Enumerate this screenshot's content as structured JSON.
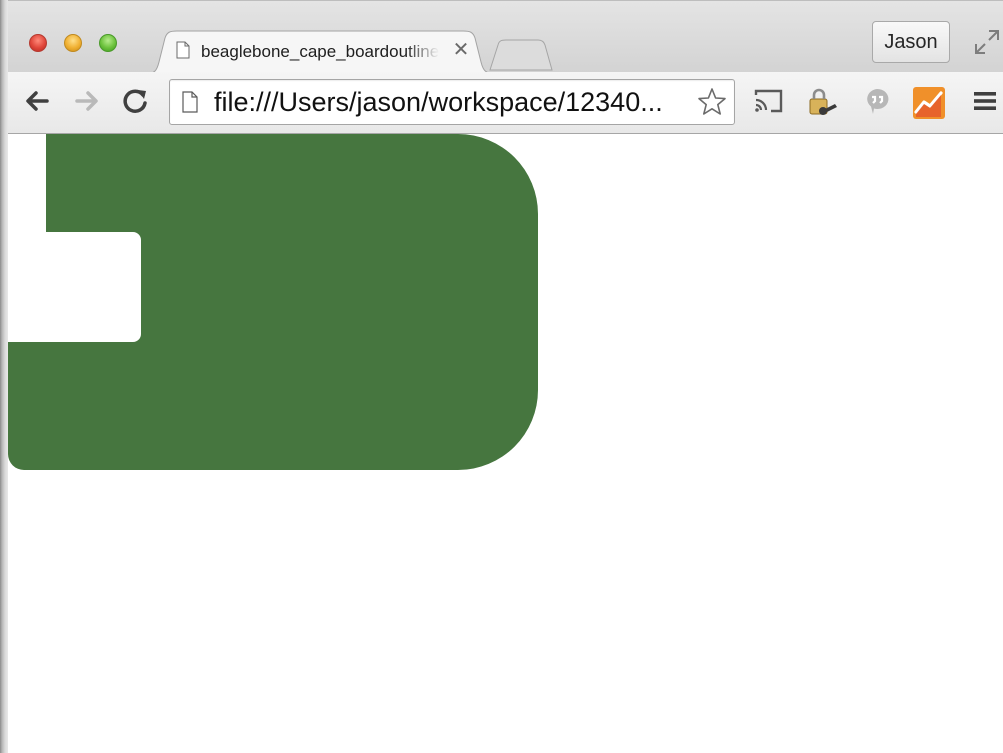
{
  "window": {
    "controls": [
      "close-icon",
      "minimize-icon",
      "maximize-icon"
    ],
    "colors": {
      "close": "#e0463a",
      "minimize": "#f0b032",
      "maximize": "#6cc23c"
    }
  },
  "tabs": [
    {
      "title": "beaglebone_cape_boardoutline",
      "icon": "document-icon",
      "close_glyph": "✕",
      "active": true
    }
  ],
  "new_tab": {
    "icon": "new-tab-icon"
  },
  "profile": {
    "label": "Jason"
  },
  "toolbar": {
    "back_icon": "back-arrow-icon",
    "forward_icon": "forward-arrow-icon",
    "reload_icon": "reload-icon",
    "address": "file:///Users/jason/workspace/12340...",
    "address_icon": "document-icon",
    "bookmark_icon": "star-icon",
    "extensions": [
      "cast-icon",
      "lock-key-icon",
      "chat-bubble-icon",
      "analytics-icon"
    ],
    "menu_icon": "hamburger-menu-icon"
  },
  "page": {
    "shape": "board-outline",
    "fill_color": "#46763f",
    "background": "#ffffff"
  }
}
